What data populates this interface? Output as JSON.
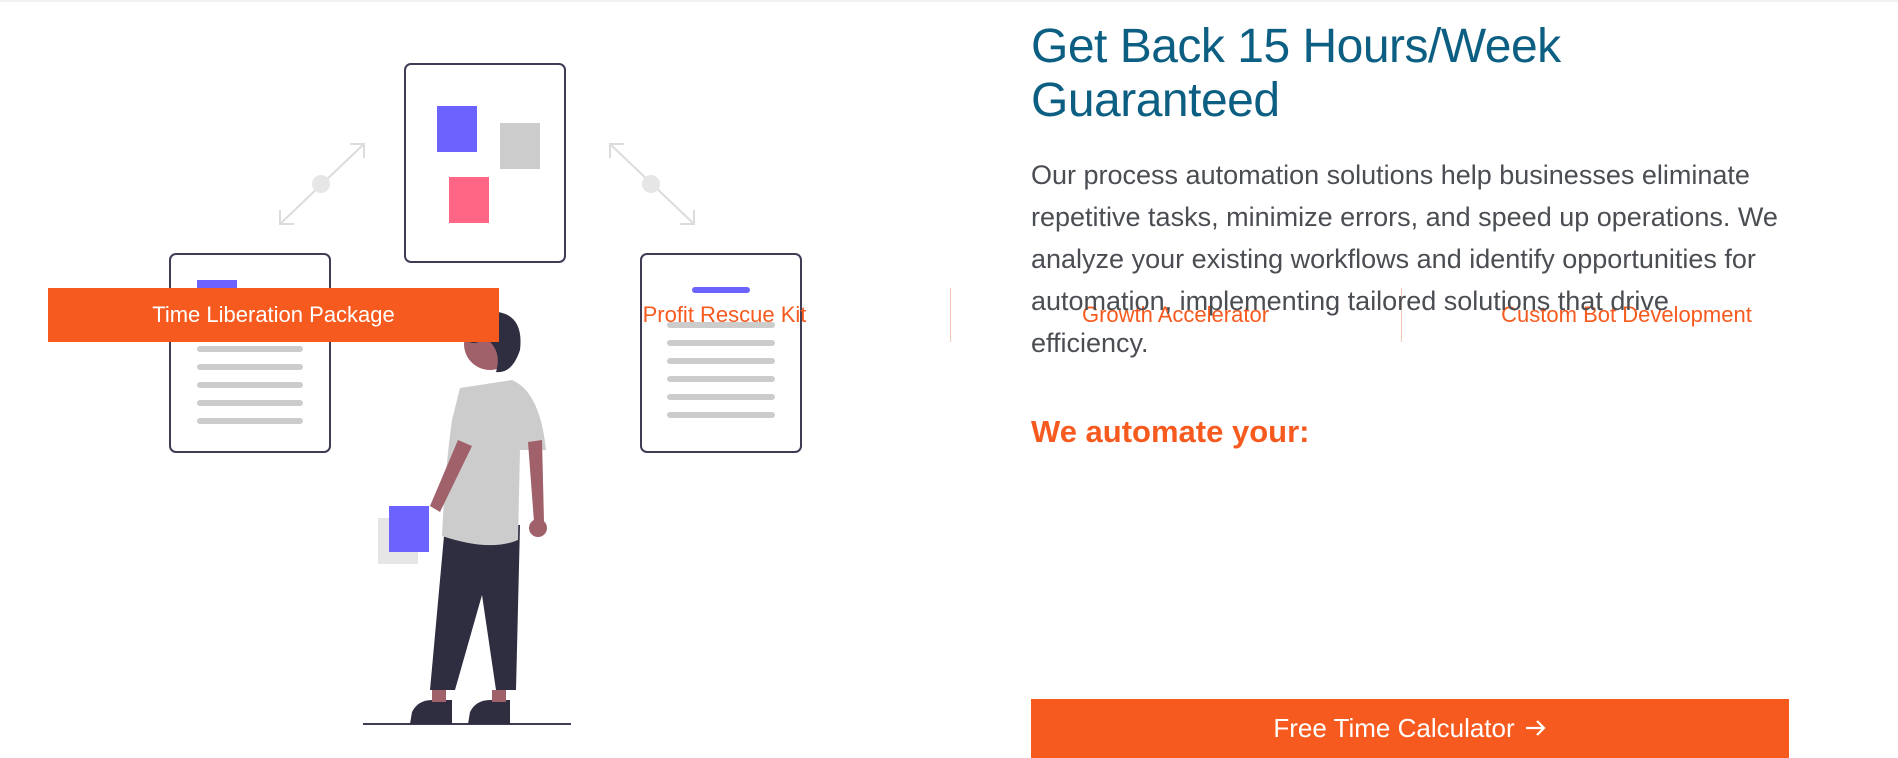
{
  "tabs": [
    {
      "label": "Time Liberation Package",
      "active": true
    },
    {
      "label": "Profit Rescue Kit",
      "active": false
    },
    {
      "label": "Growth Accelerator",
      "active": false
    },
    {
      "label": "Custom Bot Development",
      "active": false
    }
  ],
  "main": {
    "title": "Get Back 15 Hours/Week Guaranteed",
    "description": "Our process automation solutions help businesses eliminate repetitive tasks, minimize errors, and speed up operations. We analyze your existing workflows and identify opportunities for automation, implementing tailored solutions that drive efficiency.",
    "subheading": "We automate your:",
    "cta_label": "Free Time Calculator",
    "cta_icon": "arrow-right-icon"
  },
  "colors": {
    "accent": "#f75a1e",
    "heading": "#0c5f82",
    "body_text": "#4a4d52",
    "illustration_purple": "#6c63ff",
    "illustration_pink": "#ff6584",
    "illustration_dark": "#2f2e41"
  }
}
